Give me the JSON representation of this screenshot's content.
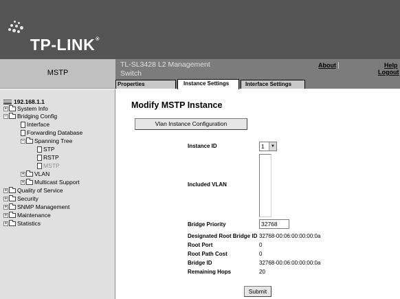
{
  "header": {
    "logo_text": "TP-LINK",
    "logo_mark": "®",
    "left_title": "MSTP",
    "mgmt_title": "TL-SL3428 L2 Management Switch",
    "about_label": "About",
    "help_label": "Help",
    "logout_label": "Logout"
  },
  "tabs": [
    {
      "label": "Properties"
    },
    {
      "label": "Instance Settings"
    },
    {
      "label": "Interface Settings"
    }
  ],
  "tree": {
    "root": "192.168.1.1",
    "items": [
      {
        "label": "System Info"
      },
      {
        "label": "Bridging Config"
      },
      {
        "label": "Interface"
      },
      {
        "label": "Forwarding Database"
      },
      {
        "label": "Spanning Tree"
      },
      {
        "label": "STP"
      },
      {
        "label": "RSTP"
      },
      {
        "label": "MSTP"
      },
      {
        "label": "VLAN"
      },
      {
        "label": "Multicast Support"
      },
      {
        "label": "Quality of Service"
      },
      {
        "label": "Security"
      },
      {
        "label": "SNMP Management"
      },
      {
        "label": "Maintenance"
      },
      {
        "label": "Statistics"
      }
    ]
  },
  "main": {
    "heading": "Modify MSTP Instance",
    "vlan_config_button": "Vlan Instance Configuration",
    "instance_id_label": "Instance ID",
    "instance_id_value": "1",
    "included_vlan_label": "Included VLAN",
    "bridge_priority_label": "Bridge Priority",
    "bridge_priority_value": "32768",
    "designated_root_label": "Designated Root Bridge ID",
    "designated_root_value": "32768-00:06:00:00:00:0a",
    "root_port_label": "Root Port",
    "root_port_value": "0",
    "root_path_cost_label": "Root Path Cost",
    "root_path_cost_value": "0",
    "bridge_id_label": "Bridge ID",
    "bridge_id_value": "32768-00:06:00:00:00:0a",
    "remaining_hops_label": "Remaining Hops",
    "remaining_hops_value": "20",
    "submit_button": "Submit"
  },
  "colors": {
    "banner": "#545454",
    "title_bar": "#7c7c7c",
    "left_title_bg": "#c0c0c0",
    "tree_bg": "#e0e0e0"
  },
  "icons": [
    "logo-dots-icon",
    "pc-icon",
    "plus-minus-icon",
    "folder-icon",
    "document-icon",
    "dropdown-arrow-icon"
  ]
}
